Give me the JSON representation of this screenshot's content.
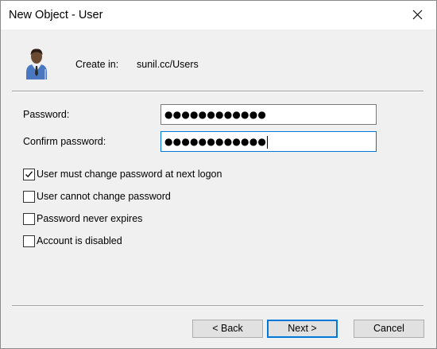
{
  "window": {
    "title": "New Object - User",
    "close_icon": "close-icon"
  },
  "header": {
    "icon": "user-icon",
    "create_in_label": "Create in:",
    "create_in_value": "sunil.cc/Users"
  },
  "fields": {
    "password_label": "Password:",
    "password_value": "●●●●●●●●●●●●",
    "confirm_label": "Confirm password:",
    "confirm_value": "●●●●●●●●●●●●"
  },
  "options": [
    {
      "label": "User must change password at next logon",
      "checked": true
    },
    {
      "label": "User cannot change password",
      "checked": false
    },
    {
      "label": "Password never expires",
      "checked": false
    },
    {
      "label": "Account is disabled",
      "checked": false
    }
  ],
  "buttons": {
    "back": "< Back",
    "next": "Next >",
    "cancel": "Cancel"
  },
  "colors": {
    "focus_accent": "#0078d7",
    "dialog_background": "#f0f0f0"
  }
}
